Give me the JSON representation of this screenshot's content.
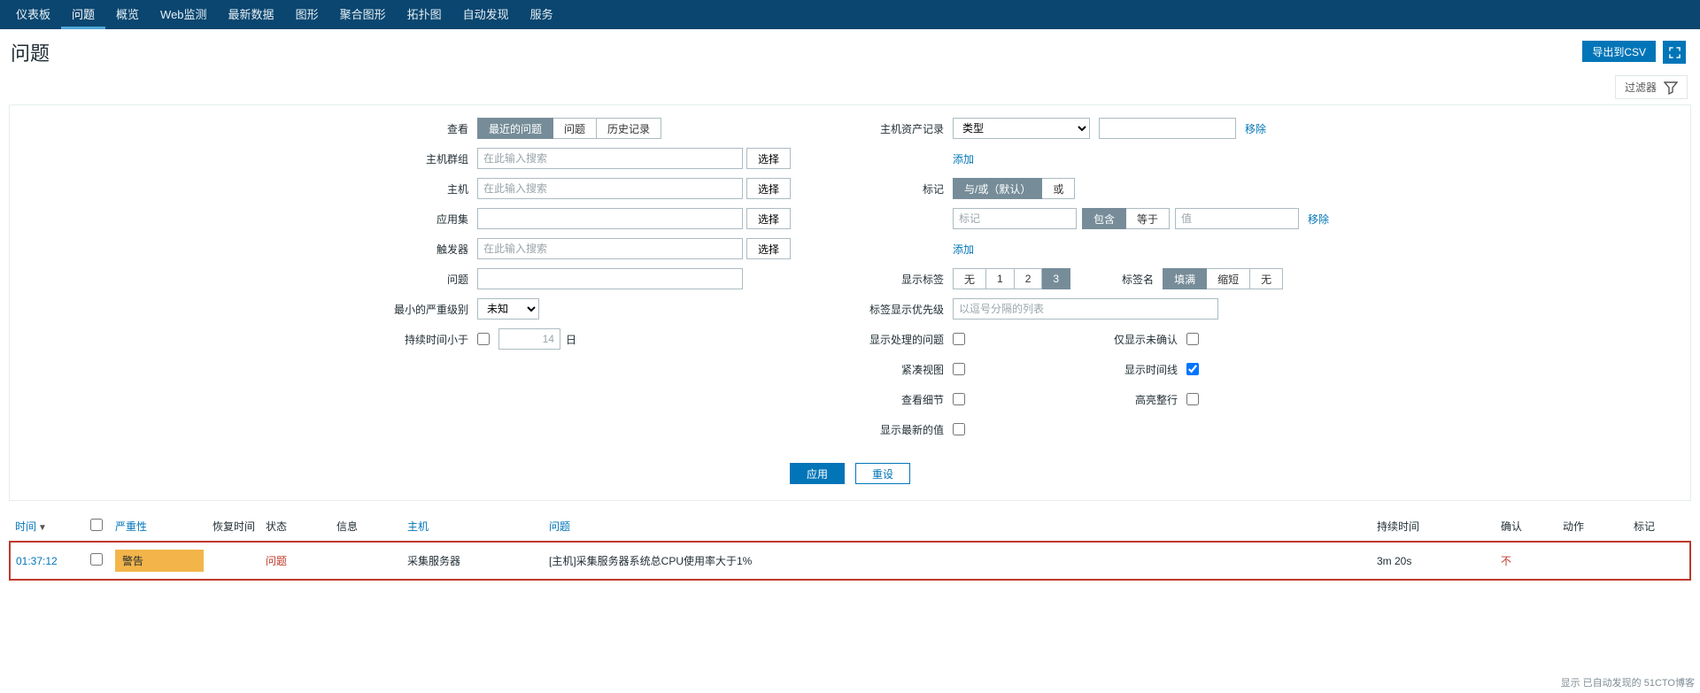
{
  "nav": {
    "items": [
      "仪表板",
      "问题",
      "概览",
      "Web监测",
      "最新数据",
      "图形",
      "聚合图形",
      "拓扑图",
      "自动发现",
      "服务"
    ],
    "active_index": 1
  },
  "header": {
    "title": "问题",
    "export_csv": "导出到CSV"
  },
  "filter_toggle": "过滤器",
  "filters_left": {
    "view_label": "查看",
    "view_options": [
      "最近的问题",
      "问题",
      "历史记录"
    ],
    "host_groups_label": "主机群组",
    "hosts_label": "主机",
    "applications_label": "应用集",
    "triggers_label": "触发器",
    "problem_label": "问题",
    "min_severity_label": "最小的严重级别",
    "min_severity_value": "未知",
    "age_less_label": "持续时间小于",
    "age_value": "14",
    "days_unit": "日",
    "search_placeholder": "在此输入搜索",
    "select_btn": "选择"
  },
  "filters_right": {
    "inventory_label": "主机资产记录",
    "inventory_type": "类型",
    "remove": "移除",
    "add": "添加",
    "tags_label": "标记",
    "tags_op": [
      "与/或（默认）",
      "或"
    ],
    "tag_placeholder": "标记",
    "contains": "包含",
    "equals": "等于",
    "value_placeholder": "值",
    "show_tags_label": "显示标签",
    "show_tags_opts": [
      "无",
      "1",
      "2",
      "3"
    ],
    "tag_name_label": "标签名",
    "tag_name_opts": [
      "填满",
      "缩短",
      "无"
    ],
    "priority_label": "标签显示优先级",
    "priority_placeholder": "以逗号分隔的列表",
    "show_handled_label": "显示处理的问题",
    "compact_label": "紧凑视图",
    "detail_label": "查看细节",
    "show_latest_label": "显示最新的值",
    "unack_label": "仅显示未确认",
    "timeline_label": "显示时间线",
    "highlight_label": "高亮整行"
  },
  "actions": {
    "apply": "应用",
    "reset": "重设"
  },
  "table": {
    "headers": {
      "time": "时间",
      "severity": "严重性",
      "recovery": "恢复时间",
      "status": "状态",
      "info": "信息",
      "host": "主机",
      "problem": "问题",
      "duration": "持续时间",
      "ack": "确认",
      "actions": "动作",
      "tags": "标记"
    },
    "rows": [
      {
        "time": "01:37:12",
        "severity": "警告",
        "recovery": "",
        "status": "问题",
        "info": "",
        "host": "采集服务器",
        "problem": "[主机]采集服务器系统总CPU使用率大于1%",
        "duration": "3m 20s",
        "ack": "不"
      }
    ]
  },
  "footer": "显示 已自动发现的 51CTO博客"
}
